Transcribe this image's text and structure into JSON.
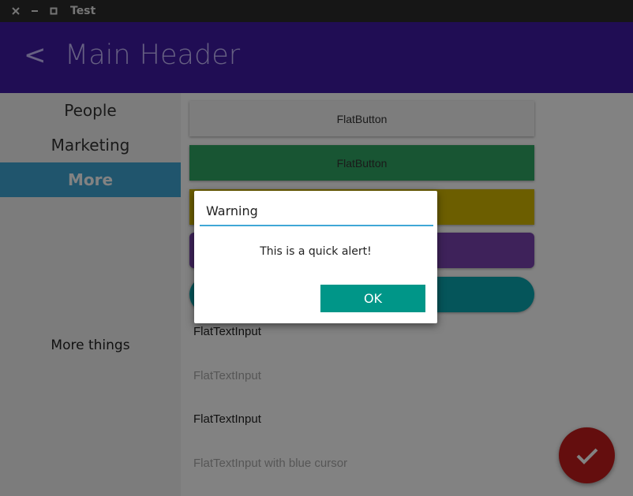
{
  "window": {
    "title": "Test",
    "close_glyph": "✕",
    "minimize_glyph": "—",
    "maximize_glyph": "□"
  },
  "header": {
    "back_glyph": "<",
    "title": "Main Header",
    "color": "#3f1aa6"
  },
  "sidebar": {
    "items": [
      {
        "label": "People",
        "active": false
      },
      {
        "label": "Marketing",
        "active": false
      },
      {
        "label": "More",
        "active": true
      }
    ],
    "note": "More things"
  },
  "content": {
    "buttons": [
      {
        "label": "FlatButton",
        "color": "#f5f5f5"
      },
      {
        "label": "FlatButton",
        "color": "#2fa864"
      },
      {
        "label": "",
        "color": "#d4b800"
      },
      {
        "label": "",
        "color": "#7a44b0"
      },
      {
        "label": "",
        "color": "#0aa8b0"
      }
    ],
    "inputs": [
      {
        "label": "FlatTextInput"
      },
      {
        "label": "FlatTextInput"
      },
      {
        "label": "FlatTextInput"
      },
      {
        "label": "FlatTextInput with blue cursor"
      }
    ]
  },
  "dialog": {
    "title": "Warning",
    "message": "This is a quick alert!",
    "ok_label": "OK"
  },
  "fab": {
    "icon": "checkmark-icon",
    "color": "#c51d1d"
  }
}
